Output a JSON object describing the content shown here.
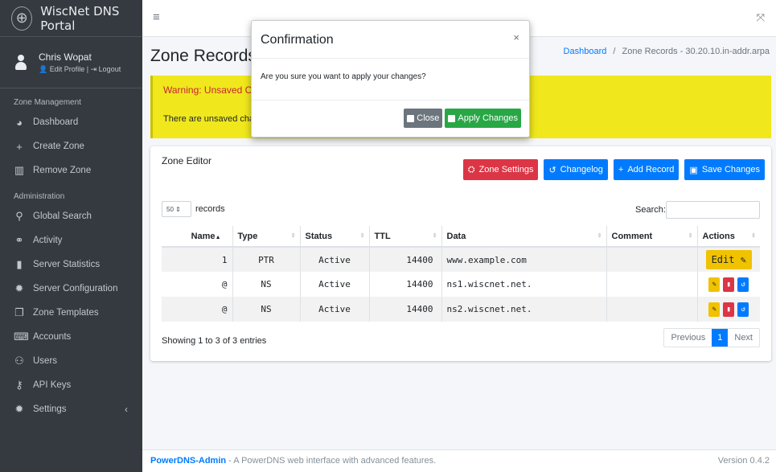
{
  "brand": {
    "title": "WiscNet DNS Portal"
  },
  "user": {
    "name": "Chris Wopat",
    "edit_profile": "Edit Profile",
    "separator": "|",
    "logout": "Logout"
  },
  "nav": {
    "zone_header": "Zone Management",
    "admin_header": "Administration",
    "zone_items": [
      {
        "label": "Dashboard",
        "icon": "dashboard-icon"
      },
      {
        "label": "Create Zone",
        "icon": "plus-icon"
      },
      {
        "label": "Remove Zone",
        "icon": "trash-icon"
      }
    ],
    "admin_items": [
      {
        "label": "Global Search",
        "icon": "search-icon"
      },
      {
        "label": "Activity",
        "icon": "activity-icon"
      },
      {
        "label": "Server Statistics",
        "icon": "chart-icon"
      },
      {
        "label": "Server Configuration",
        "icon": "gear-icon"
      },
      {
        "label": "Zone Templates",
        "icon": "copy-icon"
      },
      {
        "label": "Accounts",
        "icon": "keyboard-icon"
      },
      {
        "label": "Users",
        "icon": "users-icon"
      },
      {
        "label": "API Keys",
        "icon": "key-icon"
      },
      {
        "label": "Settings",
        "icon": "gear-icon"
      }
    ]
  },
  "header": {
    "title": "Zone Records - ",
    "breadcrumb_home": "Dashboard",
    "breadcrumb_sep": "/",
    "breadcrumb_current": "Zone Records - 30.20.10.in-addr.arpa"
  },
  "warning": {
    "title": "Warning: Unsaved Ch",
    "text": "There are unsaved chan"
  },
  "card": {
    "title": "Zone Editor",
    "buttons": {
      "zone_settings": "Zone Settings",
      "changelog": "Changelog",
      "add_record": "Add Record",
      "save_changes": "Save Changes"
    },
    "length_value": "50",
    "length_label": "records",
    "search_label": "Search:",
    "columns": [
      "Name",
      "Type",
      "Status",
      "TTL",
      "Data",
      "Comment",
      "Actions"
    ],
    "rows": [
      {
        "name": "1",
        "type": "PTR",
        "status": "Active",
        "ttl": "14400",
        "data": "www.example.com",
        "comment": "",
        "action": "Edit"
      },
      {
        "name": "@",
        "type": "NS",
        "status": "Active",
        "ttl": "14400",
        "data": "ns1.wiscnet.net.",
        "comment": ""
      },
      {
        "name": "@",
        "type": "NS",
        "status": "Active",
        "ttl": "14400",
        "data": "ns2.wiscnet.net.",
        "comment": ""
      }
    ],
    "info": "Showing 1 to 3 of 3 entries",
    "pager": {
      "previous": "Previous",
      "page": "1",
      "next": "Next"
    }
  },
  "footer": {
    "brand": "PowerDNS-Admin",
    "text": " - A PowerDNS web interface with advanced features.",
    "version": "Version 0.4.2"
  },
  "modal": {
    "title": "Confirmation",
    "close_x": "×",
    "body": "Are you sure you want to apply your changes?",
    "close_button": "Close",
    "apply_button": "Apply Changes"
  },
  "colors": {
    "sidebar": "#343a40",
    "primary": "#007bff",
    "danger": "#dc3545",
    "success": "#28a745",
    "warning_bg": "#f0e81c"
  }
}
